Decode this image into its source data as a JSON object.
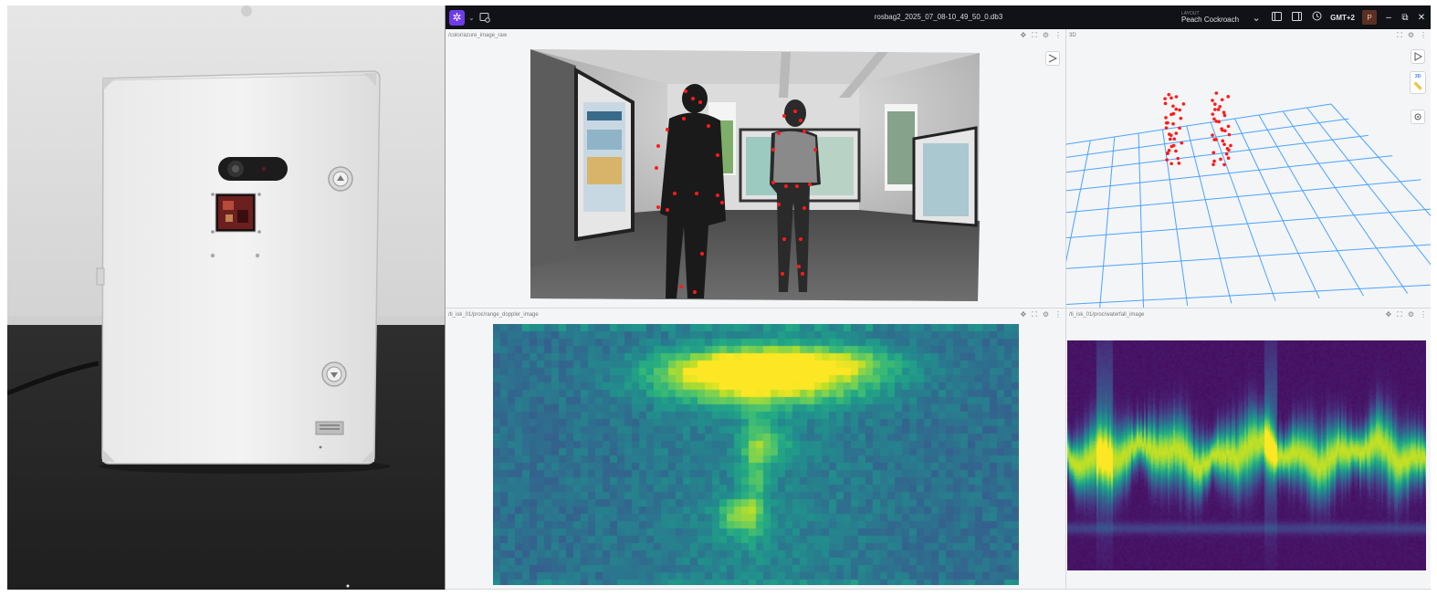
{
  "topbar": {
    "file_title": "rosbag2_2025_07_08-10_49_50_0.db3",
    "layout_caption": "LAYOUT",
    "layout_name": "Peach Cockroach",
    "layout_chevron": "⌄",
    "timezone": "GMT+2",
    "avatar_initial": "P",
    "minimize_glyph": "–",
    "restore_glyph": "⧉",
    "close_glyph": "✕"
  },
  "panels": {
    "image_raw": {
      "title": "/color/azure_image_raw"
    },
    "three_d": {
      "title": "3D",
      "tool_3d_label": "3D"
    },
    "range_doppler": {
      "title": "/ti_isk_01/proc/range_doppler_image"
    },
    "waterfall": {
      "title": "/ti_isk_01/proc/waterfall_image"
    }
  },
  "icons": {
    "app_logo": "snowflake-icon",
    "add_panel": "add-panel-icon",
    "toggle_left_sidebar": "left-sidebar-icon",
    "toggle_right_sidebar": "right-sidebar-icon",
    "panel_move": "move-icon",
    "panel_fullscreen": "fullscreen-icon",
    "panel_settings": "gear-icon",
    "panel_more": "more-vert-icon"
  },
  "colors": {
    "app_accent": "#6f3be8",
    "keypoint": "#ff1a1a",
    "grid": "#4aa3ff",
    "viridis_low": "#440154",
    "viridis_high": "#fde725"
  }
}
